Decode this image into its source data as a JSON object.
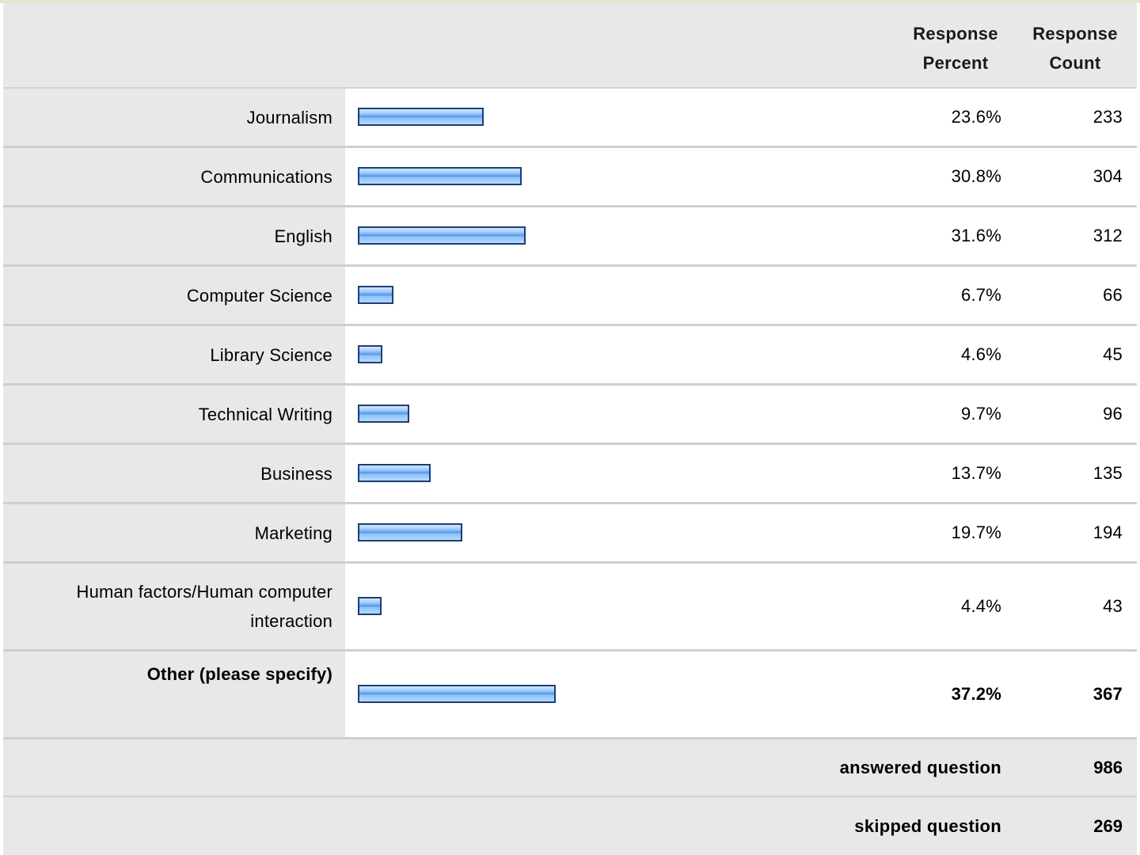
{
  "header": {
    "percent_label_line1": "Response",
    "percent_label_line2": "Percent",
    "count_label_line1": "Response",
    "count_label_line2": "Count"
  },
  "chart_data": {
    "type": "bar",
    "categories": [
      "Journalism",
      "Communications",
      "English",
      "Computer Science",
      "Library Science",
      "Technical Writing",
      "Business",
      "Marketing",
      "Human factors/Human computer interaction",
      "Other (please specify)"
    ],
    "percent_labels": [
      "23.6%",
      "30.8%",
      "31.6%",
      "6.7%",
      "4.6%",
      "9.7%",
      "13.7%",
      "19.7%",
      "4.4%",
      "37.2%"
    ],
    "values": [
      23.6,
      30.8,
      31.6,
      6.7,
      4.6,
      9.7,
      13.7,
      19.7,
      4.4,
      37.2
    ],
    "counts": [
      233,
      304,
      312,
      66,
      45,
      96,
      135,
      194,
      43,
      367
    ],
    "bar_color": "#6aa6ee",
    "bar_border_color": "#1d3f73"
  },
  "summary": {
    "answered_label": "answered question",
    "answered_value": "986",
    "skipped_label": "skipped question",
    "skipped_value": "269"
  }
}
